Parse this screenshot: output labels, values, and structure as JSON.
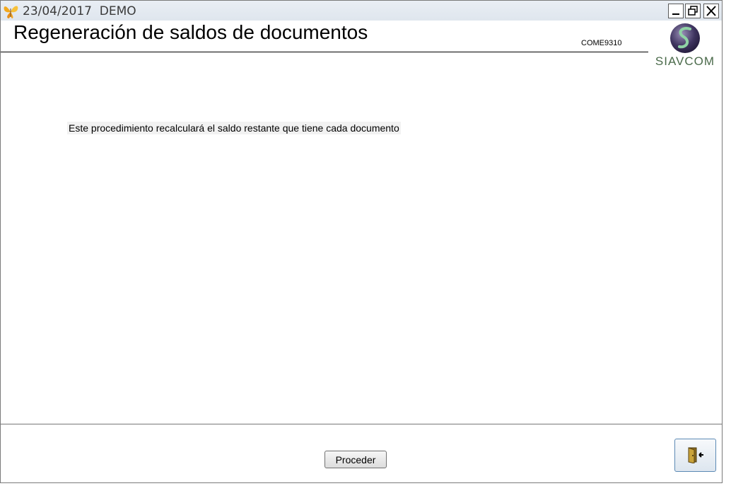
{
  "window": {
    "title": "23/04/2017  DEMO",
    "controls": {
      "minimize_icon": "minimize-icon",
      "restore_icon": "restore-icon",
      "close_icon": "close-icon"
    }
  },
  "header": {
    "title": "Regeneración de saldos de documentos",
    "program_code": "COME9310",
    "logo": {
      "text": "SIAVCOM"
    }
  },
  "main": {
    "description": "Este procedimiento recalculará el saldo restante que tiene cada documento"
  },
  "footer": {
    "proceed_label": "Proceder",
    "exit_icon": "exit-door-icon"
  },
  "colors": {
    "titlebar": "#e4eaf1",
    "logo_green": "#4a6a4a",
    "exit_border": "#5c8ab5"
  }
}
